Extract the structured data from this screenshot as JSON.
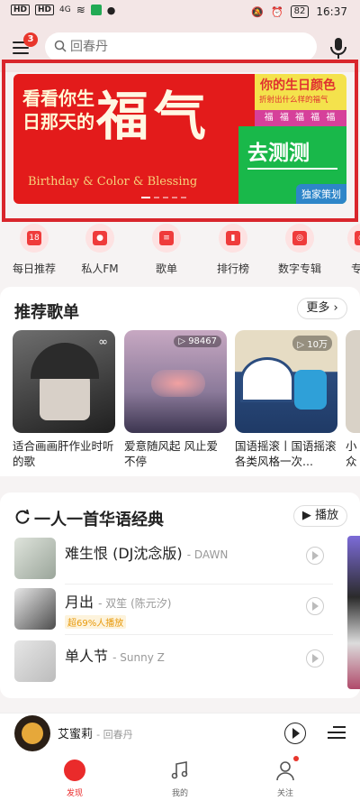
{
  "status_bar": {
    "time": "16:37",
    "battery": "82",
    "signal_1": "HD",
    "signal_2": "HD",
    "net": "4G"
  },
  "header": {
    "menu_badge": "3",
    "search_placeholder": "回春丹"
  },
  "banner": {
    "title_small": "看看你生日那天的",
    "title_big": "福气",
    "subtitle_en": "Birthday & Color & Blessing",
    "right_title": "你的生日颜色",
    "right_sub": "折射出什么样的福气",
    "fu_row": "福 福 福 福 福",
    "cta": "去测测",
    "tag": "独家策划"
  },
  "quick_nav": [
    {
      "label": "每日推荐",
      "icon": "calendar-icon"
    },
    {
      "label": "私人FM",
      "icon": "radio-icon"
    },
    {
      "label": "歌单",
      "icon": "playlist-icon"
    },
    {
      "label": "排行榜",
      "icon": "chart-icon"
    },
    {
      "label": "数字专辑",
      "icon": "album-icon"
    },
    {
      "label": "专辑",
      "icon": "album-icon"
    }
  ],
  "recommend": {
    "title": "推荐歌单",
    "more": "更多",
    "items": [
      {
        "name": "适合画画肝作业时听的歌",
        "plays": ""
      },
      {
        "name": "爱意随风起 风止爱不停",
        "plays": "98467"
      },
      {
        "name": "国语摇滚丨国语摇滚各类风格一次...",
        "plays": "10万"
      },
      {
        "name": "小众",
        "plays": ""
      }
    ]
  },
  "daily": {
    "title": "一人一首华语经典",
    "play": "播放",
    "songs": [
      {
        "title": "难生恨 (DJ沈念版)",
        "artist": "DAWN",
        "tag": ""
      },
      {
        "title": "月出",
        "artist": "双笙 (陈元汐)",
        "tag": "超69%人播放"
      },
      {
        "title": "单人节",
        "artist": "Sunny Z",
        "tag": ""
      }
    ]
  },
  "player": {
    "title": "艾蜜莉",
    "artist": "回春丹"
  },
  "tabs": [
    {
      "label": "发现"
    },
    {
      "label": "我的"
    },
    {
      "label": "关注"
    }
  ],
  "colors": {
    "accent": "#ea2b2b",
    "highlight_frame": "#d9262c"
  }
}
